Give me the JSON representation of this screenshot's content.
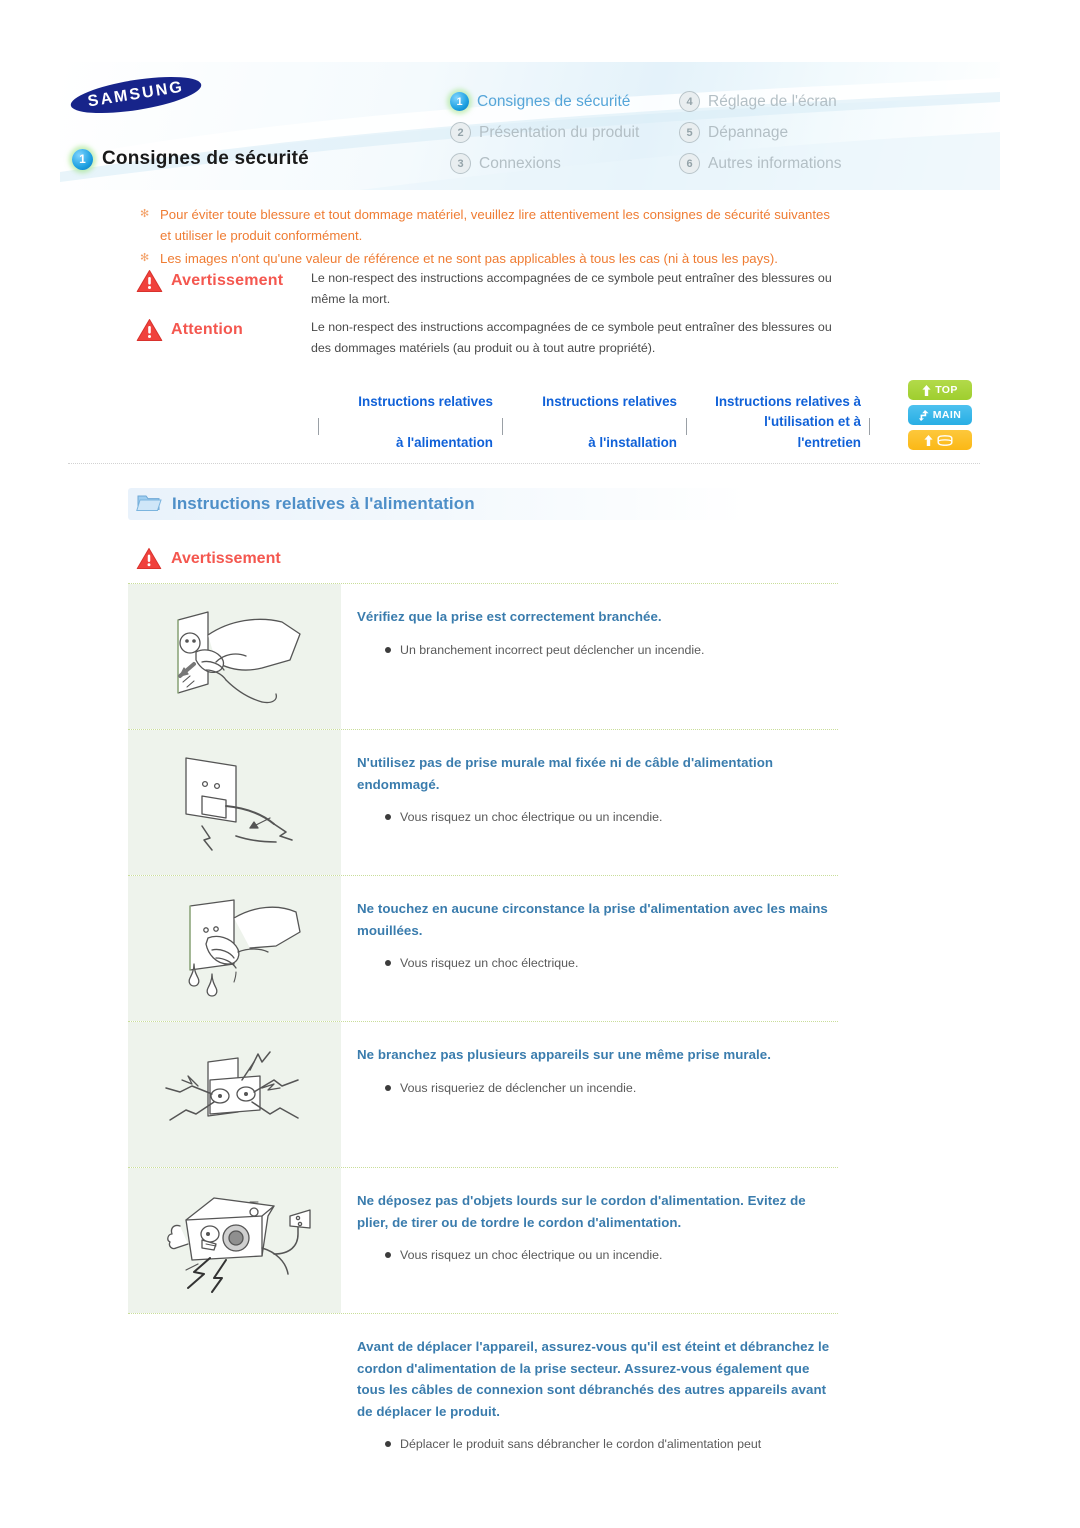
{
  "header": {
    "brand": "SAMSUNG",
    "page_badge": "1",
    "page_title": "Consignes de sécurité",
    "nav": [
      {
        "num": "1",
        "label": "Consignes de sécurité",
        "active": true,
        "name": "nav-item-consignes-de-securite"
      },
      {
        "num": "4",
        "label": "Réglage de l'écran",
        "active": false,
        "name": "nav-item-reglage-de-lecran"
      },
      {
        "num": "2",
        "label": "Présentation du produit",
        "active": false,
        "name": "nav-item-presentation-du-produit"
      },
      {
        "num": "5",
        "label": "Dépannage",
        "active": false,
        "name": "nav-item-depannage"
      },
      {
        "num": "3",
        "label": "Connexions",
        "active": false,
        "name": "nav-item-connexions"
      },
      {
        "num": "6",
        "label": "Autres informations",
        "active": false,
        "name": "nav-item-autres-informations"
      }
    ]
  },
  "intro": {
    "lines": [
      "Pour éviter toute blessure et tout dommage matériel, veuillez lire attentivement les consignes de sécurité suivantes et utiliser le produit conformément.",
      "Les images n'ont qu'une valeur de référence et ne sont pas applicables à tous les cas (ni à tous les pays)."
    ]
  },
  "legend": {
    "rows": [
      {
        "label": "Avertissement",
        "desc": "Le non-respect des instructions accompagnées de ce symbole peut entraîner des blessures ou même la mort."
      },
      {
        "label": "Attention",
        "desc": "Le non-respect des instructions accompagnées de ce symbole peut entraîner des blessures ou des dommages matériels (au produit ou à tout autre propriété)."
      }
    ]
  },
  "tabs": [
    {
      "line1": "Instructions relatives",
      "line2": "",
      "line3": "à l'alimentation"
    },
    {
      "line1": "Instructions relatives",
      "line2": "",
      "line3": "à l'installation"
    },
    {
      "line1": "Instructions relatives à",
      "line2": "l'utilisation et à",
      "line3": "l'entretien"
    }
  ],
  "side_buttons": [
    {
      "label": "TOP",
      "icon": "arrow-up-icon",
      "color": "#9fce2e"
    },
    {
      "label": "MAIN",
      "icon": "arrow-branch-icon",
      "color": "#28aee4"
    },
    {
      "label": "",
      "icon": "arrow-up-book-icon",
      "color": "#fbb816"
    }
  ],
  "section": {
    "title": "Instructions relatives à l'alimentation",
    "subhead": "Avertissement"
  },
  "items": [
    {
      "illustration": "hand-plugging-outlet",
      "heading": "Vérifiez que la prise est correctement branchée.",
      "bullets": [
        "Un branchement incorrect peut déclencher un incendie."
      ]
    },
    {
      "illustration": "damaged-wall-socket-cable",
      "heading": "N'utilisez pas de prise murale mal fixée ni de câble d'alimentation endommagé.",
      "bullets": [
        "Vous risquez un choc électrique ou un incendie."
      ]
    },
    {
      "illustration": "wet-hands-plug",
      "heading": "Ne touchez en aucune circonstance la prise d'alimentation avec les mains mouillées.",
      "bullets": [
        "Vous risquez un choc électrique."
      ]
    },
    {
      "illustration": "overloaded-outlet",
      "heading": "Ne branchez pas plusieurs appareils sur une même prise murale.",
      "bullets": [
        "Vous risqueriez de déclencher un incendie."
      ]
    },
    {
      "illustration": "heavy-object-on-cord",
      "heading": "Ne déposez pas d'objets lourds sur le cordon d'alimentation. Evitez de plier, de tirer ou de tordre le cordon d'alimentation.",
      "bullets": [
        "Vous risquez un choc électrique ou un incendie."
      ]
    },
    {
      "illustration": "",
      "heading": "Avant de déplacer l'appareil, assurez-vous qu'il est éteint et débranchez le cordon d'alimentation de la prise secteur. Assurez-vous également que tous les câbles de connexion sont débranchés des autres appareils avant de déplacer le produit.",
      "bullets": [
        "Déplacer le produit sans débrancher le cordon d'alimentation peut"
      ]
    }
  ]
}
